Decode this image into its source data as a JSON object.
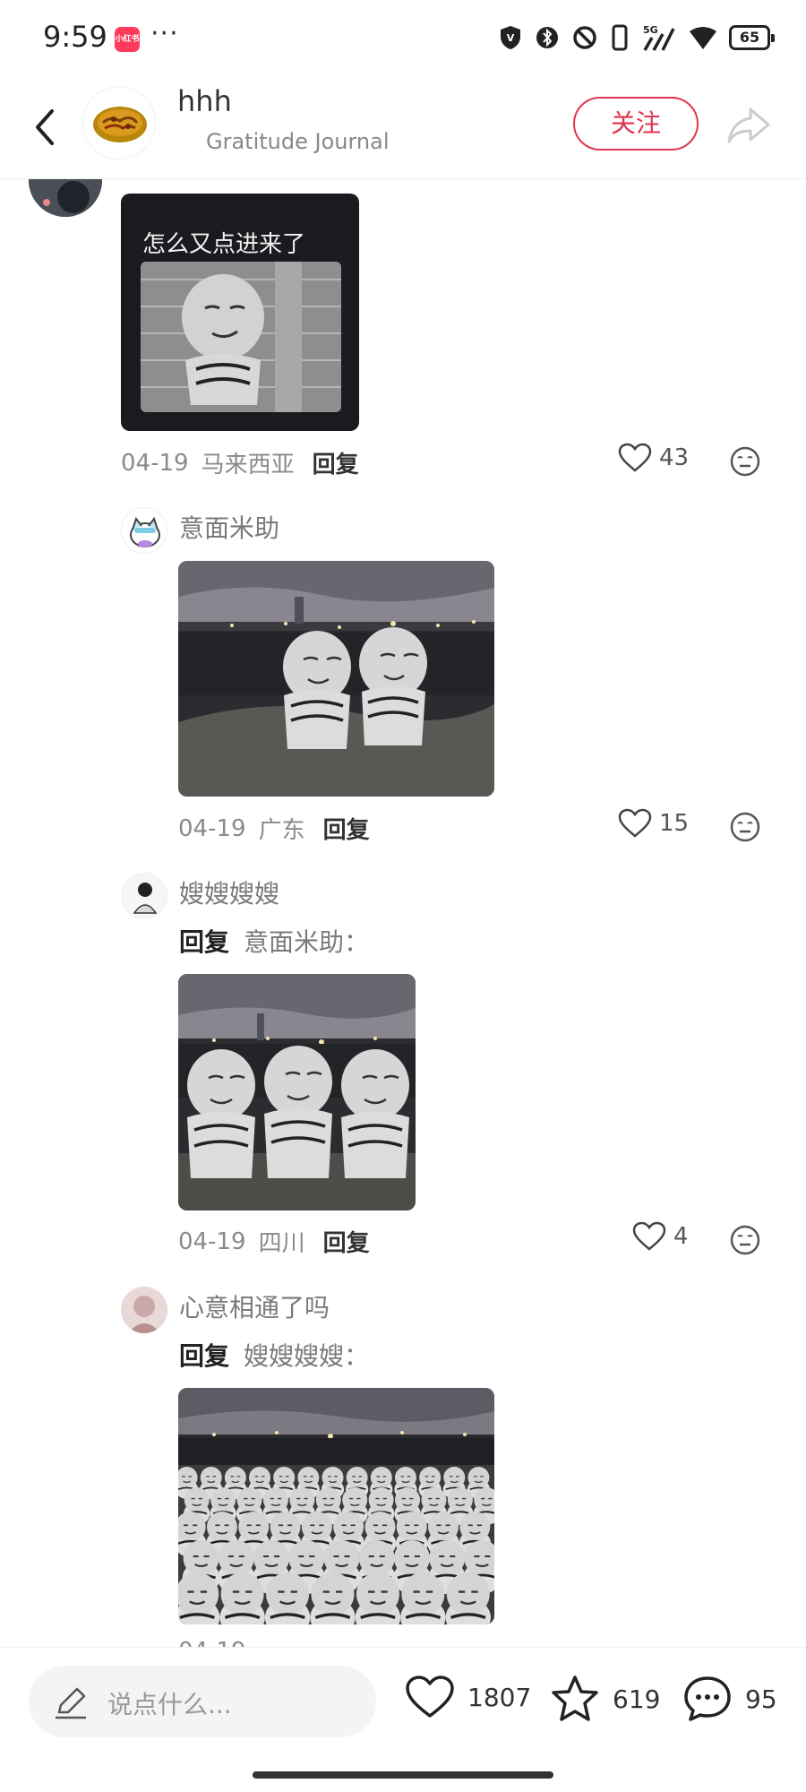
{
  "status_bar": {
    "time": "9:59",
    "app_badge": "小红书",
    "more": "···",
    "network": "5G",
    "battery": "65"
  },
  "header": {
    "username": "hhh",
    "subtitle": "Gratitude Journal",
    "follow_label": "关注"
  },
  "comments": [
    {
      "caption": "怎么又点进来了",
      "date": "04-19",
      "location": "马来西亚",
      "reply_label": "回复",
      "likes": "43"
    },
    {
      "username": "意面米助",
      "date": "04-19",
      "location": "广东",
      "reply_label": "回复",
      "likes": "15"
    },
    {
      "username": "嫂嫂嫂嫂",
      "reply_prefix": "回复",
      "reply_to": "意面米助：",
      "date": "04-19",
      "location": "四川",
      "reply_label": "回复",
      "likes": "4"
    },
    {
      "username": "心意相通了吗",
      "reply_prefix": "回复",
      "reply_to": "嫂嫂嫂嫂："
    }
  ],
  "bottom_bar": {
    "placeholder": "说点什么...",
    "likes": "1807",
    "stars": "619",
    "comments": "95"
  },
  "colors": {
    "accent": "#e0364e",
    "muted": "#8a8a8a"
  }
}
